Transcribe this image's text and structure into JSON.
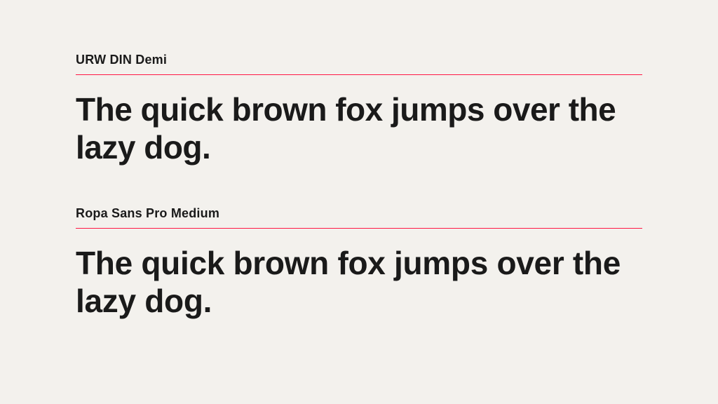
{
  "samples": [
    {
      "font_name": "URW DIN Demi",
      "text": "The quick brown fox jumps over the lazy dog."
    },
    {
      "font_name": "Ropa Sans Pro Medium",
      "text": "The quick brown fox jumps over the lazy dog."
    }
  ],
  "accent_color": "#ff1744"
}
